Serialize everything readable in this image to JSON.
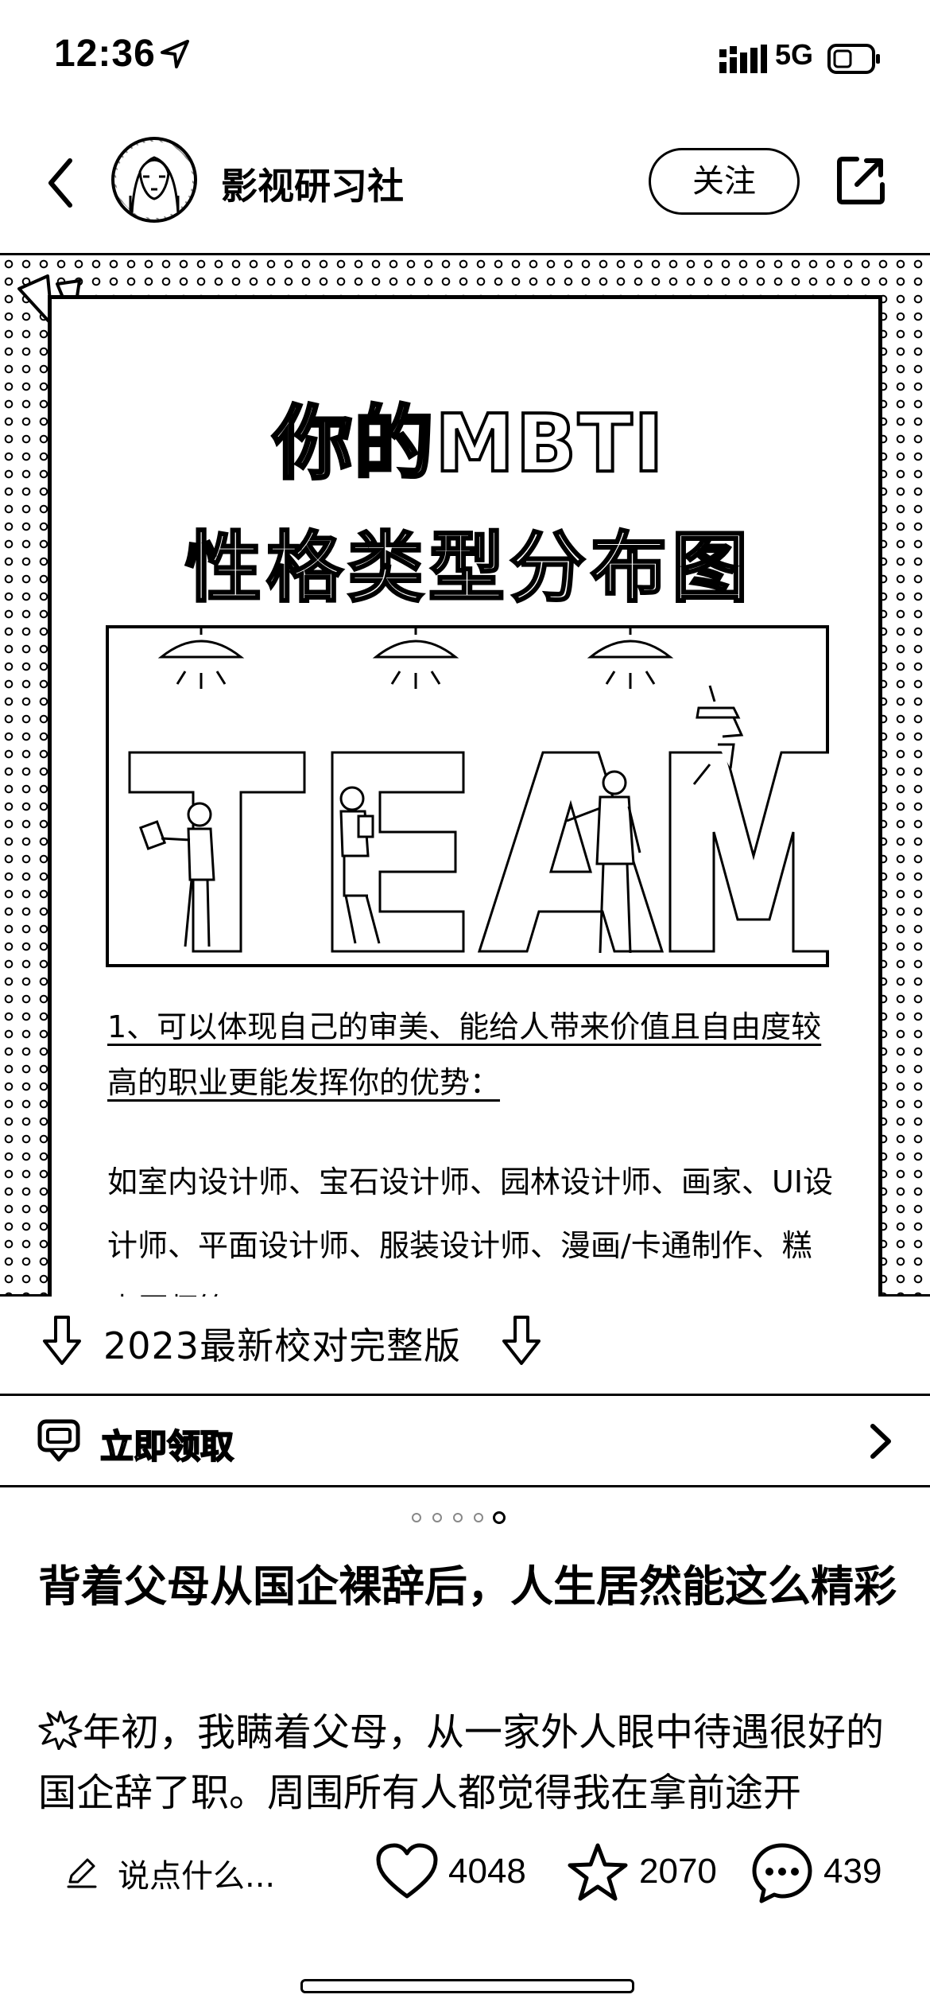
{
  "status_bar": {
    "time": "12:36",
    "network": "5G"
  },
  "header": {
    "author_name": "影视研习社",
    "follow_label": "关注"
  },
  "poster": {
    "title_line1": "你的MBTI",
    "title_line2": "性格类型分布图",
    "illustration_word": "TEAM",
    "advantage_heading": "1、可以体现自己的审美、能给人带来价值且自由度较高的职业更能发挥你的优势：",
    "advantage_list": "如室内设计师、宝石设计师、园林设计师、画家、UI设计师、平面设计师、服装设计师、漫画/卡通制作、糕点厨师等。"
  },
  "banner": {
    "text": "2023最新校对完整版",
    "claim_label": "立即领取"
  },
  "pager": {
    "total": 5,
    "active": 5
  },
  "post": {
    "title": "背着父母从国企裸辞后，人生居然能这么精彩",
    "body": "年初，我瞒着父母，从一家外人眼中待遇很好的国企辞了职。周围所有人都觉得我在拿前途开"
  },
  "bottom_bar": {
    "comment_placeholder": "说点什么...",
    "like_count": "4048",
    "collect_count": "2070",
    "comment_count": "439"
  },
  "colors": {
    "ink": "#000000",
    "paper": "#ffffff"
  }
}
